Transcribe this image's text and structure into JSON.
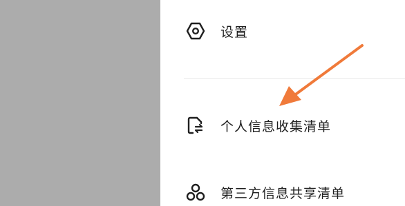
{
  "drawer": {
    "items": [
      {
        "label": "设置",
        "icon": "settings-hexagon-icon"
      },
      {
        "label": "个人信息收集清单",
        "icon": "document-exchange-icon"
      },
      {
        "label": "第三方信息共享清单",
        "icon": "share-nodes-icon"
      }
    ]
  },
  "annotation": {
    "icon": "orange-arrow",
    "color": "#f07a3a"
  },
  "colors": {
    "overlay": "#acacac",
    "panel": "#ffffff",
    "text": "#1f1f1f",
    "divider": "#e9e9e9"
  }
}
